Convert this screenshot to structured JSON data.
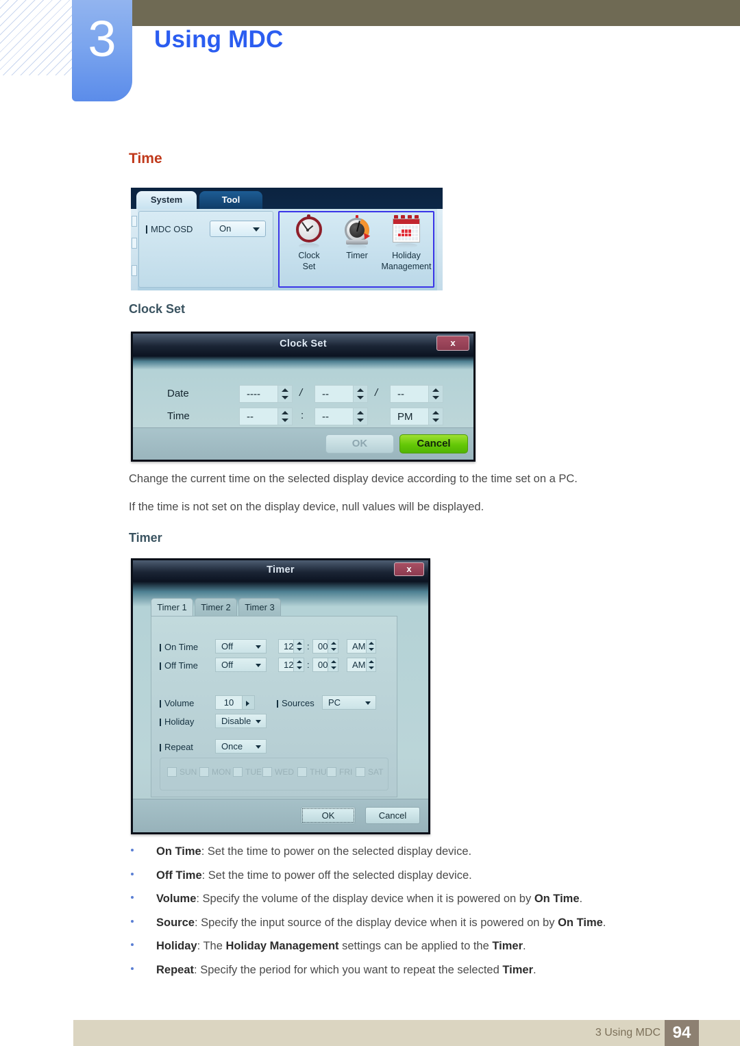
{
  "chapter": {
    "number": "3",
    "title": "Using MDC"
  },
  "sections": {
    "time_heading": "Time",
    "clock_set_heading": "Clock Set",
    "timer_heading": "Timer",
    "para1": "Change the current time on the selected display device according to the time set on a PC.",
    "para2": "If the time is not set on the display device, null values will be displayed."
  },
  "ribbon": {
    "tab_system": "System",
    "tab_tool": "Tool",
    "mdc_osd_label": "MDC OSD",
    "mdc_osd_value": "On",
    "items": [
      {
        "label_line1": "Clock",
        "label_line2": "Set",
        "icon": "alarm-clock-icon"
      },
      {
        "label_line1": "Timer",
        "label_line2": "",
        "icon": "kitchen-timer-icon"
      },
      {
        "label_line1": "Holiday",
        "label_line2": "Management",
        "icon": "calendar-icon"
      }
    ]
  },
  "clock_set_dialog": {
    "title": "Clock Set",
    "close_label": "x",
    "date_label": "Date",
    "time_label": "Time",
    "date_year": "----",
    "date_month": "--",
    "date_day": "--",
    "time_hour": "--",
    "time_minute": "--",
    "time_meridiem": "PM",
    "separator_date": "/",
    "separator_time": ":",
    "ok_label": "OK",
    "cancel_label": "Cancel"
  },
  "timer_dialog": {
    "title": "Timer",
    "close_label": "x",
    "tabs": [
      "Timer 1",
      "Timer 2",
      "Timer 3"
    ],
    "on_time_label": "On Time",
    "on_time_value": "Off",
    "on_time_hour": "12",
    "on_time_minute": "00",
    "on_time_meridiem": "AM",
    "off_time_label": "Off Time",
    "off_time_value": "Off",
    "off_time_hour": "12",
    "off_time_minute": "00",
    "off_time_meridiem": "AM",
    "volume_label": "Volume",
    "volume_value": "10",
    "sources_label": "Sources",
    "sources_value": "PC",
    "holiday_label": "Holiday",
    "holiday_value": "Disable",
    "repeat_label": "Repeat",
    "repeat_value": "Once",
    "days": [
      "SUN",
      "MON",
      "TUE",
      "WED",
      "THU",
      "FRI",
      "SAT"
    ],
    "colon": ":",
    "ok_label": "OK",
    "cancel_label": "Cancel"
  },
  "bullets": [
    {
      "term": "On Time",
      "rest": ": Set the time to power on the selected display device."
    },
    {
      "term": "Off Time",
      "rest": ": Set the time to power off the selected display device."
    },
    {
      "term": "Volume",
      "rest": ": Specify the volume of the display device when it is powered on by ",
      "term2": "On Time",
      "tail": "."
    },
    {
      "term": "Source",
      "rest": ": Specify the input source of the display device when it is powered on by ",
      "term2": "On Time",
      "tail": "."
    },
    {
      "term": "Holiday",
      "rest": ": The ",
      "term2": "Holiday Management",
      "mid": " settings can be applied to the ",
      "term3": "Timer",
      "tail": "."
    },
    {
      "term": "Repeat",
      "rest": ": Specify the period for which you want to repeat the selected ",
      "term2": "Timer",
      "tail": "."
    }
  ],
  "footer": {
    "text": "3 Using MDC",
    "page": "94"
  },
  "colors": {
    "accent_red": "#c0391b",
    "chapter_blue": "#2b5df0",
    "header_olive": "#6f6a54",
    "footer_beige": "#dbd5c1",
    "footer_page_brown": "#8d8071"
  }
}
